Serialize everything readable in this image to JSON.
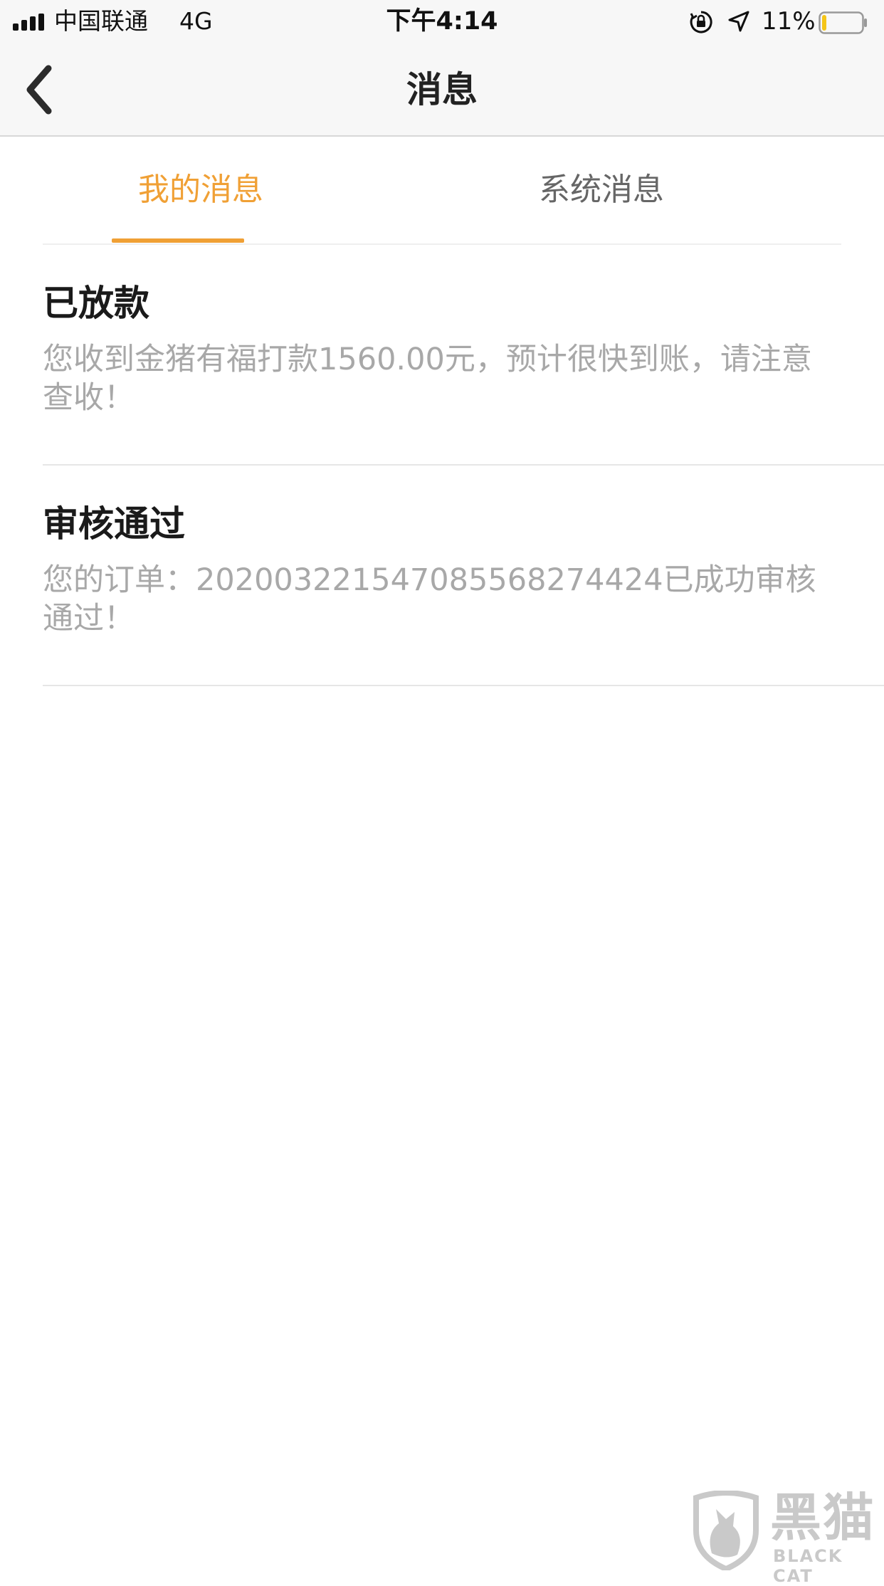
{
  "status_bar": {
    "carrier": "中国联通",
    "network": "4G",
    "time": "下午4:14",
    "battery_percent": "11%",
    "battery_level": 0.11,
    "battery_color": "#f5c518",
    "icons": [
      "signal-icon",
      "lock-rotation-icon",
      "location-icon",
      "battery-icon"
    ]
  },
  "nav": {
    "title": "消息",
    "back_icon": "chevron-left-icon"
  },
  "tabs": [
    {
      "label": "我的消息",
      "active": true
    },
    {
      "label": "系统消息",
      "active": false
    }
  ],
  "accent_color": "#f0a035",
  "messages": [
    {
      "title": "已放款",
      "body": "您收到金猪有福打款1560.00元，预计很快到账，请注意查收！"
    },
    {
      "title": "审核通过",
      "body": "您的订单：2020032215470855682744​24已成功审核通过！"
    }
  ],
  "watermark": {
    "logo_text": "黑猫",
    "logo_sub": "BLACK CAT"
  }
}
